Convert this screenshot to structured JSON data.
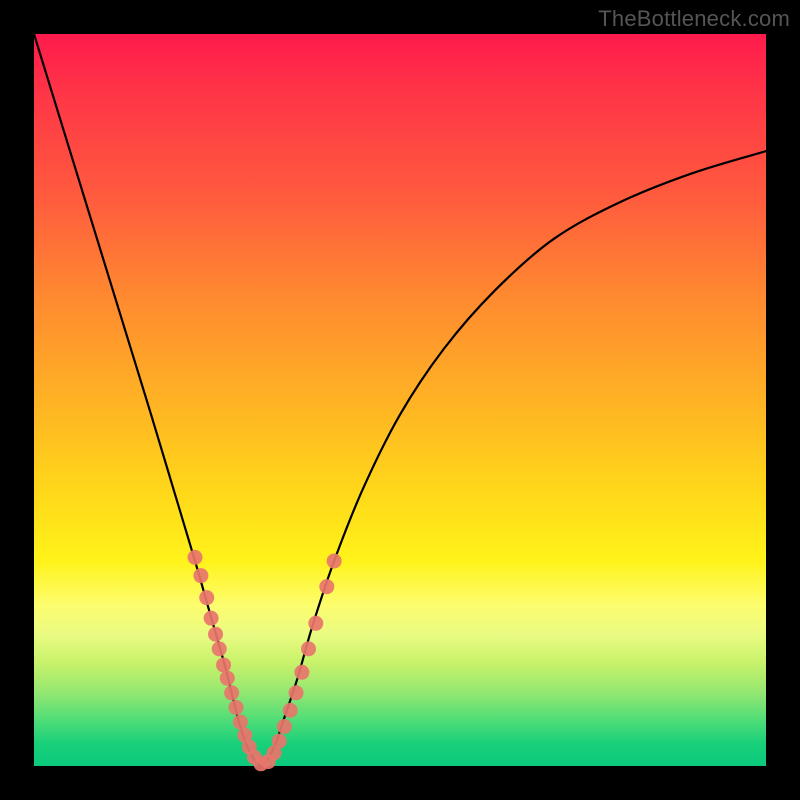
{
  "watermark": "TheBottleneck.com",
  "chart_data": {
    "type": "line",
    "title": "",
    "xlabel": "",
    "ylabel": "",
    "xlim": [
      0,
      100
    ],
    "ylim": [
      0,
      100
    ],
    "grid": false,
    "legend": false,
    "series": [
      {
        "name": "curve",
        "x": [
          0,
          4,
          8,
          12,
          16,
          19,
          22,
          24,
          26,
          27,
          28,
          29,
          30,
          31,
          32,
          33,
          34,
          36,
          38,
          41,
          45,
          50,
          56,
          63,
          71,
          80,
          90,
          100
        ],
        "y": [
          100,
          87,
          74,
          61,
          48,
          38,
          28,
          21,
          14,
          10,
          6,
          3,
          1,
          0,
          1,
          3,
          6,
          12,
          19,
          28,
          38,
          48,
          57,
          65,
          72,
          77,
          81,
          84
        ]
      }
    ],
    "scatter": [
      {
        "name": "markers",
        "color": "#e8756b",
        "points": [
          {
            "x": 22.0,
            "y": 28.5
          },
          {
            "x": 22.8,
            "y": 26.0
          },
          {
            "x": 23.6,
            "y": 23.0
          },
          {
            "x": 24.2,
            "y": 20.2
          },
          {
            "x": 24.8,
            "y": 18.0
          },
          {
            "x": 25.3,
            "y": 16.0
          },
          {
            "x": 25.9,
            "y": 13.8
          },
          {
            "x": 26.4,
            "y": 12.0
          },
          {
            "x": 27.0,
            "y": 10.0
          },
          {
            "x": 27.6,
            "y": 8.0
          },
          {
            "x": 28.2,
            "y": 6.0
          },
          {
            "x": 28.8,
            "y": 4.2
          },
          {
            "x": 29.4,
            "y": 2.6
          },
          {
            "x": 30.1,
            "y": 1.2
          },
          {
            "x": 31.0,
            "y": 0.3
          },
          {
            "x": 32.0,
            "y": 0.6
          },
          {
            "x": 32.8,
            "y": 1.8
          },
          {
            "x": 33.5,
            "y": 3.4
          },
          {
            "x": 34.2,
            "y": 5.4
          },
          {
            "x": 35.0,
            "y": 7.6
          },
          {
            "x": 35.8,
            "y": 10.0
          },
          {
            "x": 36.6,
            "y": 12.8
          },
          {
            "x": 37.5,
            "y": 16.0
          },
          {
            "x": 38.5,
            "y": 19.5
          },
          {
            "x": 40.0,
            "y": 24.5
          },
          {
            "x": 41.0,
            "y": 28.0
          }
        ]
      }
    ]
  }
}
